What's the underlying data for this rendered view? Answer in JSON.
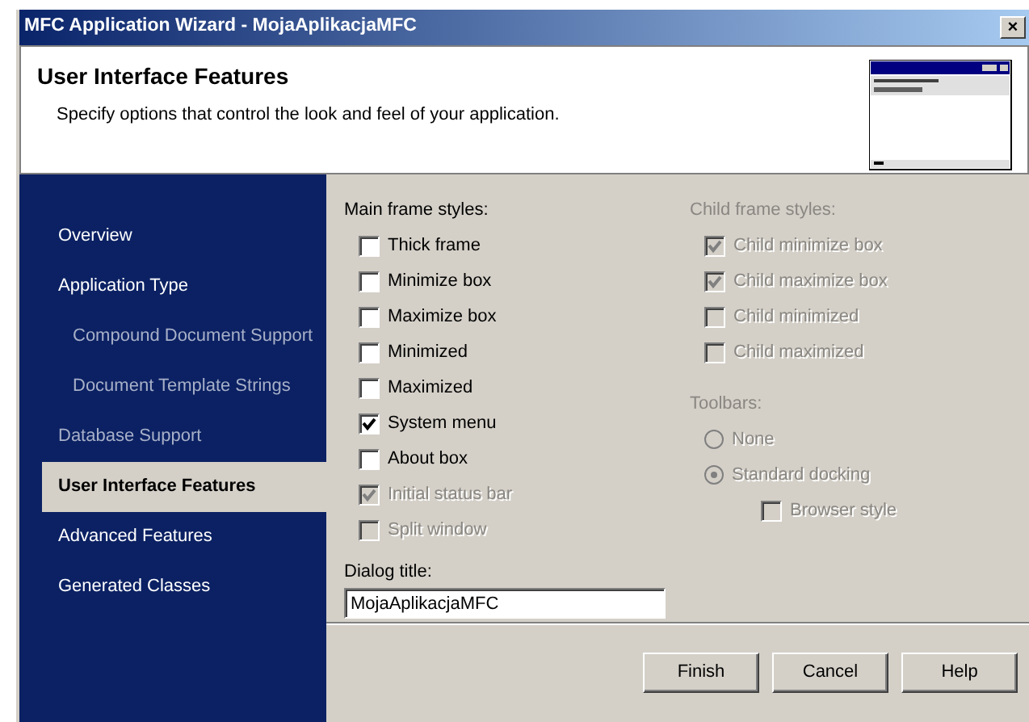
{
  "window": {
    "title": "MFC Application Wizard - MojaAplikacjaMFC",
    "close": "×"
  },
  "header": {
    "title": "User Interface Features",
    "subtitle": "Specify options that control the look and feel of your application."
  },
  "sidebar": {
    "items": [
      {
        "label": "Overview",
        "selected": false,
        "disabled": false
      },
      {
        "label": "Application Type",
        "selected": false,
        "disabled": false,
        "children": [
          {
            "label": "Compound Document Support",
            "selected": false,
            "disabled": true
          },
          {
            "label": "Document Template Strings",
            "selected": false,
            "disabled": true
          }
        ]
      },
      {
        "label": "Database Support",
        "selected": false,
        "disabled": true
      },
      {
        "label": "User Interface Features",
        "selected": true,
        "disabled": false
      },
      {
        "label": "Advanced Features",
        "selected": false,
        "disabled": false
      },
      {
        "label": "Generated Classes",
        "selected": false,
        "disabled": false
      }
    ]
  },
  "main_frame": {
    "label": "Main frame styles:",
    "options": [
      {
        "label": "Thick frame",
        "checked": false,
        "disabled": false
      },
      {
        "label": "Minimize box",
        "checked": false,
        "disabled": false
      },
      {
        "label": "Maximize box",
        "checked": false,
        "disabled": false
      },
      {
        "label": "Minimized",
        "checked": false,
        "disabled": false
      },
      {
        "label": "Maximized",
        "checked": false,
        "disabled": false
      },
      {
        "label": "System menu",
        "checked": true,
        "disabled": false
      },
      {
        "label": "About box",
        "checked": false,
        "disabled": false
      },
      {
        "label": "Initial status bar",
        "checked": true,
        "disabled": true
      },
      {
        "label": "Split window",
        "checked": false,
        "disabled": true
      }
    ]
  },
  "dialog_title": {
    "label": "Dialog title:",
    "value": "MojaAplikacjaMFC"
  },
  "child_frame": {
    "label": "Child frame styles:",
    "disabled": true,
    "options": [
      {
        "label": "Child minimize box",
        "checked": true,
        "disabled": true
      },
      {
        "label": "Child maximize box",
        "checked": true,
        "disabled": true
      },
      {
        "label": "Child minimized",
        "checked": false,
        "disabled": true
      },
      {
        "label": "Child maximized",
        "checked": false,
        "disabled": true
      }
    ]
  },
  "toolbars": {
    "label": "Toolbars:",
    "disabled": true,
    "options": [
      {
        "kind": "radio",
        "label": "None",
        "selected": false,
        "disabled": true
      },
      {
        "kind": "radio",
        "label": "Standard docking",
        "selected": true,
        "disabled": true
      },
      {
        "kind": "checkbox",
        "label": "Browser style",
        "checked": false,
        "disabled": true
      }
    ]
  },
  "buttons": [
    "Finish",
    "Cancel",
    "Help"
  ]
}
